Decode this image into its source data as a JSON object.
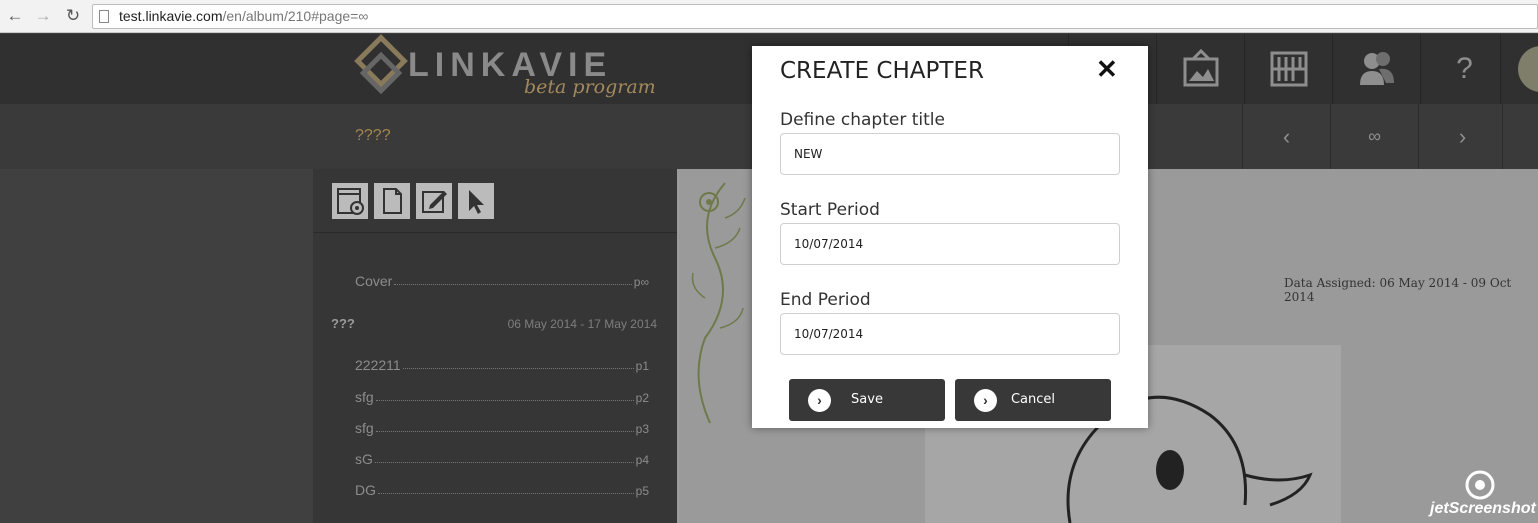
{
  "browser": {
    "url_host": "test.linkavie.com",
    "url_path": "/en/album/210#page=∞",
    "icons": [
      "back-icon",
      "forward-icon",
      "reload-icon"
    ]
  },
  "header": {
    "logo_text": "LINKAVIE",
    "logo_sub": "beta program",
    "icons": [
      "album-frame-icon",
      "bookshelf-icon",
      "users-icon"
    ],
    "help": "?"
  },
  "subheader": {
    "chapter_name": "????",
    "prev": "‹",
    "infinity": "∞",
    "next": "›"
  },
  "toolbar": {
    "icons": [
      "settings-doc-icon",
      "page-icon",
      "edit-icon",
      "cursor-icon"
    ]
  },
  "toc": {
    "cover": {
      "label": "Cover",
      "page": "p∞"
    },
    "chapter": {
      "title": "???",
      "range": "06 May 2014 - 17 May 2014"
    },
    "pages": [
      {
        "label": "222211",
        "page": "p1"
      },
      {
        "label": "sfg",
        "page": "p2"
      },
      {
        "label": "sfg",
        "page": "p3"
      },
      {
        "label": "sG",
        "page": "p4"
      },
      {
        "label": "DG",
        "page": "p5"
      }
    ]
  },
  "page_view": {
    "date_assigned": "Data Assigned: 06 May 2014 - 09 Oct 2014"
  },
  "modal": {
    "title": "CREATE CHAPTER",
    "close": "✕",
    "title_label": "Define chapter title",
    "title_value": "NEW",
    "start_label": "Start Period",
    "start_value": "10/07/2014",
    "end_label": "End Period",
    "end_value": "10/07/2014",
    "save": "Save",
    "cancel": "Cancel"
  },
  "watermark": "jetScreenshot",
  "colors": {
    "accent": "#a3874f",
    "dark": "#303030",
    "button": "#383838"
  }
}
